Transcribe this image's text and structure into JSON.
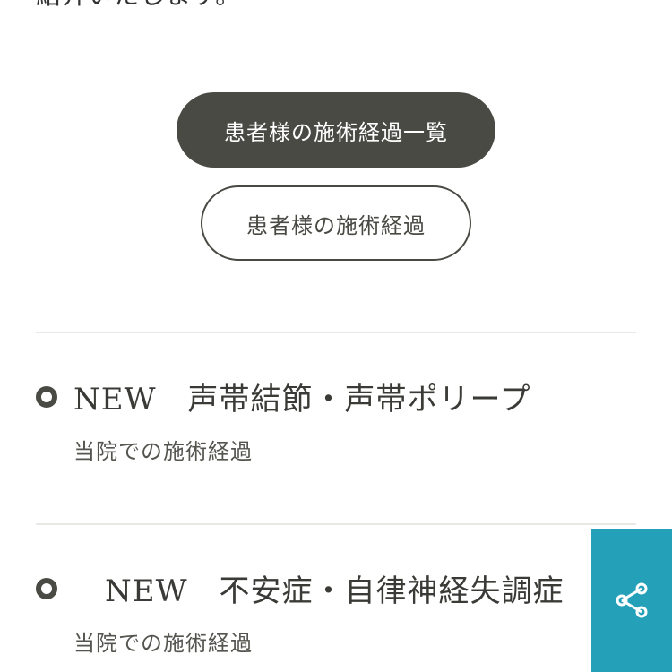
{
  "intro": {
    "text": "紹介いたします。"
  },
  "buttons": {
    "list_label": "患者様の施術経過一覧",
    "progress_label": "患者様の施術経過"
  },
  "entries": [
    {
      "title": "NEW　声帯結節・声帯ポリープ",
      "subtitle": "当院での施術経過"
    },
    {
      "title": "　NEW　不安症・自律神経失調症",
      "subtitle": "当院での施術経過"
    }
  ],
  "share": {
    "icon": "share-icon",
    "color": "#24a0b8"
  }
}
